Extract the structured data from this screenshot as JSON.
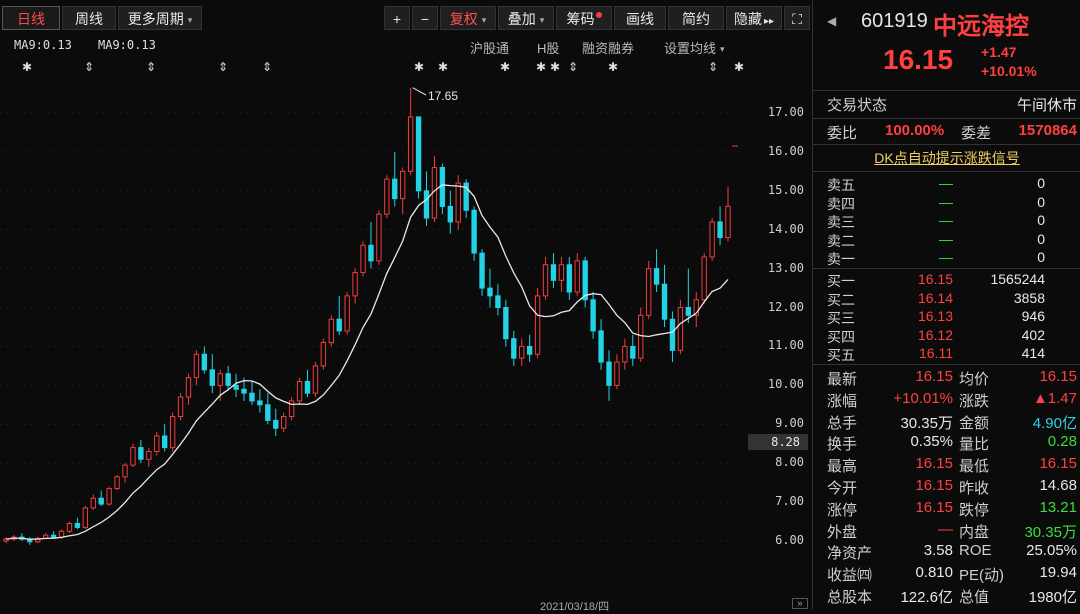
{
  "toolbar": {
    "daily": "日线",
    "weekly": "周线",
    "more_period": "更多周期",
    "plus": "+",
    "minus": "−",
    "restore": "复权",
    "overlay": "叠加",
    "chips": "筹码",
    "draw": "画线",
    "simple": "简约",
    "hide": "隐藏",
    "more_arrow": "▸▸"
  },
  "indicators": {
    "ma9_a": "MA9:0.13",
    "ma9_b": "MA9:0.13",
    "links": [
      "沪股通",
      "H股",
      "融资融券",
      "设置均线"
    ]
  },
  "chart_data": {
    "type": "candlestick",
    "y_ticks": [
      "17.00",
      "16.00",
      "15.00",
      "14.00",
      "13.00",
      "12.00",
      "11.00",
      "10.00",
      "9.00",
      "8.00",
      "7.00",
      "6.00"
    ],
    "current_price_tag": "8.28",
    "high_annotation": "17.65",
    "date_label": "2021/03/18/四",
    "series": [
      {
        "name": "MA9:0.13",
        "kind": "ma"
      }
    ],
    "candles": [
      [
        6.0,
        6.1,
        5.95,
        6.05
      ],
      [
        6.05,
        6.15,
        6.0,
        6.1
      ],
      [
        6.1,
        6.2,
        6.0,
        6.05
      ],
      [
        6.05,
        6.1,
        5.9,
        5.98
      ],
      [
        5.98,
        6.1,
        5.95,
        6.07
      ],
      [
        6.07,
        6.2,
        6.05,
        6.15
      ],
      [
        6.15,
        6.25,
        6.08,
        6.1
      ],
      [
        6.1,
        6.3,
        6.05,
        6.25
      ],
      [
        6.25,
        6.5,
        6.2,
        6.45
      ],
      [
        6.45,
        6.6,
        6.3,
        6.35
      ],
      [
        6.35,
        6.9,
        6.3,
        6.85
      ],
      [
        6.85,
        7.2,
        6.8,
        7.1
      ],
      [
        7.1,
        7.3,
        6.9,
        6.95
      ],
      [
        6.95,
        7.4,
        6.9,
        7.35
      ],
      [
        7.35,
        7.7,
        7.3,
        7.65
      ],
      [
        7.65,
        8.0,
        7.5,
        7.95
      ],
      [
        7.95,
        8.5,
        7.9,
        8.4
      ],
      [
        8.4,
        8.6,
        8.0,
        8.1
      ],
      [
        8.1,
        8.4,
        7.9,
        8.3
      ],
      [
        8.3,
        8.8,
        8.2,
        8.7
      ],
      [
        8.7,
        9.0,
        8.3,
        8.4
      ],
      [
        8.4,
        9.3,
        8.3,
        9.2
      ],
      [
        9.2,
        9.8,
        9.1,
        9.7
      ],
      [
        9.7,
        10.3,
        9.5,
        10.2
      ],
      [
        10.2,
        10.9,
        10.0,
        10.8
      ],
      [
        10.8,
        11.0,
        10.3,
        10.4
      ],
      [
        10.4,
        10.8,
        9.8,
        10.0
      ],
      [
        10.0,
        10.4,
        9.6,
        10.3
      ],
      [
        10.3,
        10.5,
        9.9,
        10.0
      ],
      [
        10.0,
        10.3,
        9.7,
        9.9
      ],
      [
        9.9,
        10.2,
        9.6,
        9.8
      ],
      [
        9.8,
        10.1,
        9.5,
        9.6
      ],
      [
        9.6,
        9.9,
        9.3,
        9.5
      ],
      [
        9.5,
        9.8,
        9.0,
        9.1
      ],
      [
        9.1,
        9.4,
        8.7,
        8.9
      ],
      [
        8.9,
        9.3,
        8.8,
        9.2
      ],
      [
        9.2,
        9.7,
        9.1,
        9.6
      ],
      [
        9.6,
        10.2,
        9.5,
        10.1
      ],
      [
        10.1,
        10.4,
        9.7,
        9.8
      ],
      [
        9.8,
        10.6,
        9.7,
        10.5
      ],
      [
        10.5,
        11.2,
        10.4,
        11.1
      ],
      [
        11.1,
        11.8,
        11.0,
        11.7
      ],
      [
        11.7,
        12.3,
        11.3,
        11.4
      ],
      [
        11.4,
        12.4,
        11.3,
        12.3
      ],
      [
        12.3,
        13.0,
        12.1,
        12.9
      ],
      [
        12.9,
        13.7,
        12.8,
        13.6
      ],
      [
        13.6,
        14.2,
        13.0,
        13.2
      ],
      [
        13.2,
        14.5,
        13.1,
        14.4
      ],
      [
        14.4,
        15.4,
        14.3,
        15.3
      ],
      [
        15.3,
        16.0,
        14.6,
        14.8
      ],
      [
        14.8,
        15.6,
        14.4,
        15.5
      ],
      [
        15.5,
        17.65,
        15.4,
        16.9
      ],
      [
        16.9,
        16.9,
        14.8,
        15.0
      ],
      [
        15.0,
        15.5,
        14.1,
        14.3
      ],
      [
        14.3,
        15.9,
        14.2,
        15.6
      ],
      [
        15.6,
        15.7,
        14.4,
        14.6
      ],
      [
        14.6,
        15.0,
        13.9,
        14.2
      ],
      [
        14.2,
        15.4,
        14.0,
        15.2
      ],
      [
        15.2,
        15.3,
        14.3,
        14.5
      ],
      [
        14.5,
        14.6,
        13.2,
        13.4
      ],
      [
        13.4,
        13.5,
        12.3,
        12.5
      ],
      [
        12.5,
        13.0,
        12.0,
        12.3
      ],
      [
        12.3,
        12.6,
        11.8,
        12.0
      ],
      [
        12.0,
        12.2,
        11.0,
        11.2
      ],
      [
        11.2,
        11.4,
        10.5,
        10.7
      ],
      [
        10.7,
        11.2,
        10.5,
        11.0
      ],
      [
        11.0,
        11.3,
        10.6,
        10.8
      ],
      [
        10.8,
        12.5,
        10.7,
        12.3
      ],
      [
        12.3,
        13.3,
        12.2,
        13.1
      ],
      [
        13.1,
        13.4,
        12.5,
        12.7
      ],
      [
        12.7,
        13.3,
        12.4,
        13.1
      ],
      [
        13.1,
        13.3,
        12.2,
        12.4
      ],
      [
        12.4,
        13.4,
        12.3,
        13.2
      ],
      [
        13.2,
        13.3,
        12.0,
        12.2
      ],
      [
        12.2,
        12.4,
        11.2,
        11.4
      ],
      [
        11.4,
        11.7,
        10.4,
        10.6
      ],
      [
        10.6,
        10.9,
        9.6,
        10.0
      ],
      [
        10.0,
        10.8,
        9.9,
        10.6
      ],
      [
        10.6,
        11.2,
        10.4,
        11.0
      ],
      [
        11.0,
        11.3,
        10.5,
        10.7
      ],
      [
        10.7,
        12.0,
        10.6,
        11.8
      ],
      [
        11.8,
        13.2,
        11.7,
        13.0
      ],
      [
        13.0,
        13.5,
        12.4,
        12.6
      ],
      [
        12.6,
        13.1,
        11.5,
        11.7
      ],
      [
        11.7,
        11.9,
        10.6,
        10.9
      ],
      [
        10.9,
        12.2,
        10.8,
        12.0
      ],
      [
        12.0,
        13.0,
        11.6,
        11.8
      ],
      [
        11.8,
        12.4,
        11.5,
        12.2
      ],
      [
        12.2,
        13.4,
        12.1,
        13.3
      ],
      [
        13.3,
        14.3,
        13.2,
        14.2
      ],
      [
        14.2,
        14.6,
        13.6,
        13.8
      ],
      [
        13.8,
        15.1,
        13.7,
        14.6
      ]
    ]
  },
  "stock": {
    "code": "601919",
    "name": "中远海控",
    "price": "16.15",
    "change": "+1.47",
    "change_pct": "+10.01%"
  },
  "status": {
    "trade_label": "交易状态",
    "trade_value": "午间休市",
    "ratio_label": "委比",
    "ratio_value": "100.00%",
    "diff_label": "委差",
    "diff_value": "1570864",
    "signal_link": "DK点自动提示涨跌信号"
  },
  "order_book": {
    "asks": [
      {
        "name": "卖五",
        "price": "—",
        "vol": "0"
      },
      {
        "name": "卖四",
        "price": "—",
        "vol": "0"
      },
      {
        "name": "卖三",
        "price": "—",
        "vol": "0"
      },
      {
        "name": "卖二",
        "price": "—",
        "vol": "0"
      },
      {
        "name": "卖一",
        "price": "—",
        "vol": "0"
      }
    ],
    "bids": [
      {
        "name": "买一",
        "price": "16.15",
        "vol": "1565244"
      },
      {
        "name": "买二",
        "price": "16.14",
        "vol": "3858"
      },
      {
        "name": "买三",
        "price": "16.13",
        "vol": "946"
      },
      {
        "name": "买四",
        "price": "16.12",
        "vol": "402"
      },
      {
        "name": "买五",
        "price": "16.11",
        "vol": "414"
      }
    ]
  },
  "quotes": [
    {
      "l1": "最新",
      "v1": "16.15",
      "c1": "red",
      "l2": "均价",
      "v2": "16.15",
      "c2": "red"
    },
    {
      "l1": "涨幅",
      "v1": "+10.01%",
      "c1": "red",
      "l2": "涨跌",
      "v2": "▲1.47",
      "c2": "red"
    },
    {
      "l1": "总手",
      "v1": "30.35万",
      "c1": "white",
      "l2": "金额",
      "v2": "4.90亿",
      "c2": "cyan"
    },
    {
      "l1": "换手",
      "v1": "0.35%",
      "c1": "white",
      "l2": "量比",
      "v2": "0.28",
      "c2": "green"
    },
    {
      "l1": "最高",
      "v1": "16.15",
      "c1": "red",
      "l2": "最低",
      "v2": "16.15",
      "c2": "red"
    },
    {
      "l1": "今开",
      "v1": "16.15",
      "c1": "red",
      "l2": "昨收",
      "v2": "14.68",
      "c2": "white"
    },
    {
      "l1": "涨停",
      "v1": "16.15",
      "c1": "red",
      "l2": "跌停",
      "v2": "13.21",
      "c2": "green"
    },
    {
      "l1": "外盘",
      "v1": "—",
      "c1": "red",
      "l2": "内盘",
      "v2": "30.35万",
      "c2": "green"
    },
    {
      "l1": "净资产",
      "v1": "3.58",
      "c1": "white",
      "l2": "ROE",
      "v2": "25.05%",
      "c2": "white"
    },
    {
      "l1": "收益㈣",
      "v1": "0.810",
      "c1": "white",
      "l2": "PE(动)",
      "v2": "19.94",
      "c2": "white"
    },
    {
      "l1": "总股本",
      "v1": "122.6亿",
      "c1": "white",
      "l2": "总值",
      "v2": "1980亿",
      "c2": "white"
    }
  ],
  "colors": {
    "up": "#f03c3c",
    "down": "#22d3e6",
    "ma": "#e8e8e8"
  }
}
